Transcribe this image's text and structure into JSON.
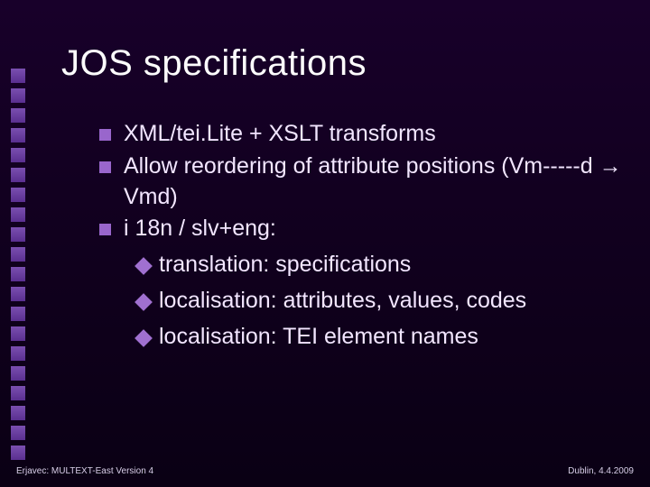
{
  "title": "JOS specifications",
  "bullets": {
    "b0": "XML/tei.Lite + XSLT transforms",
    "b1": "Allow reordering of attribute positions (Vm-----d → Vmd)",
    "b2": "i 18n / slv+eng:"
  },
  "sub": {
    "s0": "translation: specifications",
    "s1": "localisation: attributes, values, codes",
    "s2": "localisation: TEI element names"
  },
  "footer": {
    "left": "Erjavec: MULTEXT-East Version 4",
    "right": "Dublin, 4.4.2009"
  }
}
